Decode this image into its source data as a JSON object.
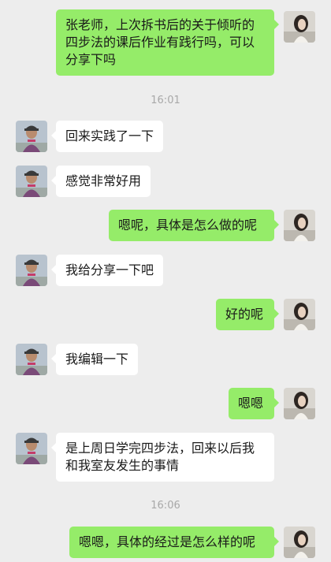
{
  "conversation": {
    "timestamps": [
      "16:01",
      "16:06"
    ],
    "messages": [
      {
        "sender": "me",
        "text": "张老师，上次拆书后的关于倾听的四步法的课后作业有践行吗，可以分享下吗"
      },
      {
        "sender": "other",
        "text": "回来实践了一下"
      },
      {
        "sender": "other",
        "text": "感觉非常好用"
      },
      {
        "sender": "me",
        "text": "嗯呢，具体是怎么做的呢"
      },
      {
        "sender": "other",
        "text": "我给分享一下吧"
      },
      {
        "sender": "me",
        "text": "好的呢"
      },
      {
        "sender": "other",
        "text": "我编辑一下"
      },
      {
        "sender": "me",
        "text": "嗯嗯"
      },
      {
        "sender": "other",
        "text": "是上周日学完四步法，回来以后我和我室友发生的事情"
      },
      {
        "sender": "me",
        "text": "嗯嗯，具体的经过是怎么样的呢"
      }
    ]
  },
  "colors": {
    "background": "#ededed",
    "my_bubble": "#95ec69",
    "their_bubble": "#ffffff",
    "timestamp_text": "#a8a8a8"
  },
  "icons": {
    "my_avatar": "avatar-woman-photo",
    "their_avatar": "avatar-man-photo"
  }
}
